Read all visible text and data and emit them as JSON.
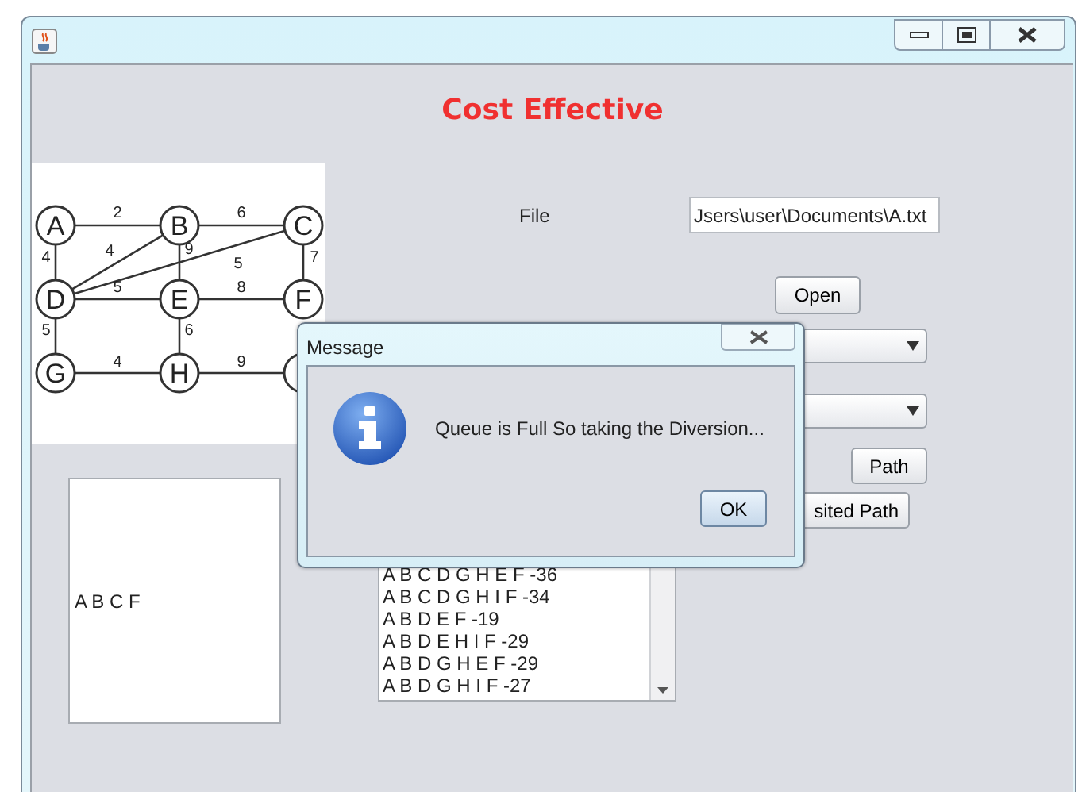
{
  "heading": "Cost Effective",
  "graph": {
    "nodes": [
      "A",
      "B",
      "C",
      "D",
      "E",
      "F",
      "G",
      "H"
    ],
    "edge_weights": [
      "2",
      "6",
      "4",
      "4",
      "9",
      "5",
      "7",
      "5",
      "8",
      "5",
      "6",
      "4",
      "9"
    ]
  },
  "file": {
    "label": "File",
    "value": "Jsers\\user\\Documents\\A.txt"
  },
  "open_button": "Open",
  "path_button": "Path",
  "visited_button": "sited Path",
  "result": "A B C F",
  "paths": [
    "A B C D G H E F -36",
    "A B C D G H I F -34",
    "A B D E F -19",
    "A B D E H I F -29",
    "A B D G H E F -29",
    "A B D G H I F -27"
  ],
  "dialog": {
    "title": "Message",
    "message": "Queue is Full So taking the Diversion...",
    "button": "OK"
  }
}
